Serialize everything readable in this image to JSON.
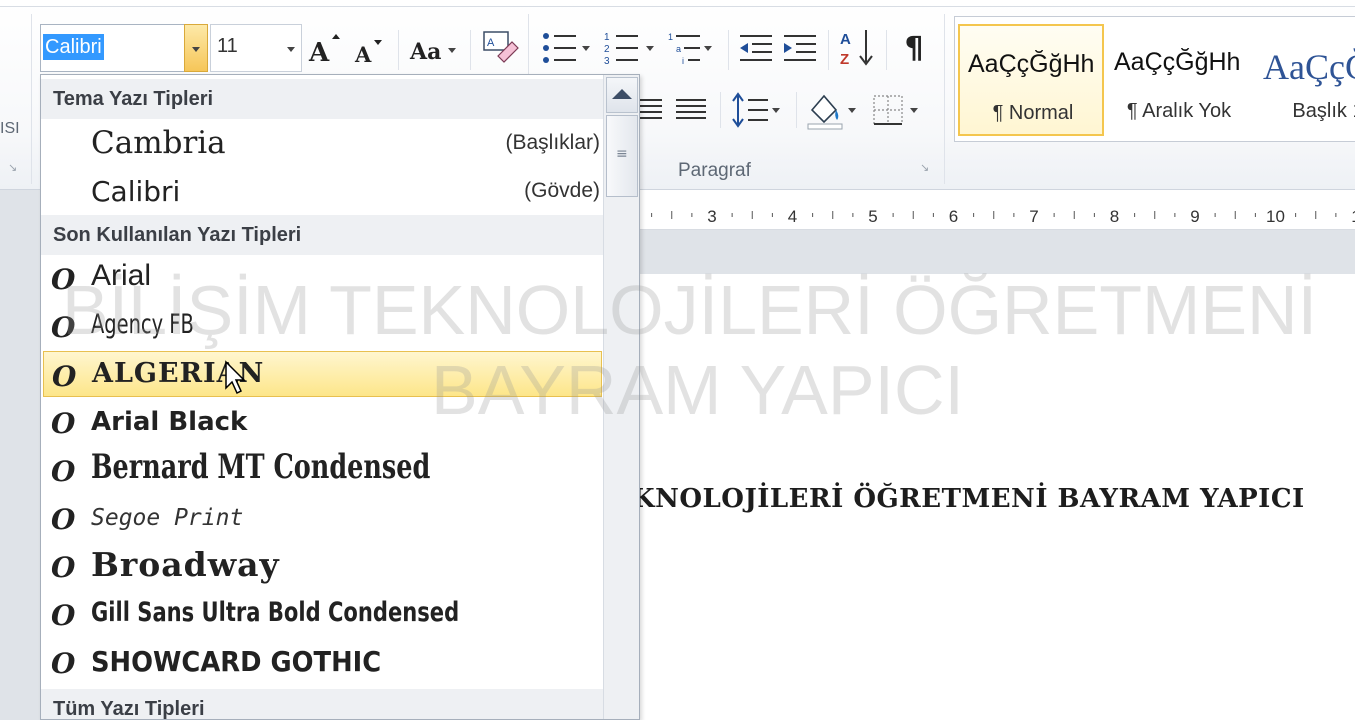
{
  "ribbon": {
    "font_name": "Calibri",
    "font_size": "11",
    "paragraph_label": "Paragraf",
    "left_cut_label": "ISI",
    "pilcrow": "¶",
    "styles": [
      {
        "sample": "AaÇçĞğHh",
        "name": "¶ Normal"
      },
      {
        "sample": "AaÇçĞğHh",
        "name": "¶ Aralık Yok"
      },
      {
        "sample": "AaÇçĞ",
        "name": "Başlık 1"
      }
    ]
  },
  "font_dropdown": {
    "theme_header": "Tema Yazı Tipleri",
    "theme_fonts": [
      {
        "name": "Cambria",
        "role": "(Başlıklar)"
      },
      {
        "name": "Calibri",
        "role": "(Gövde)"
      }
    ],
    "recent_header": "Son Kullanılan Yazı Tipleri",
    "recent_fonts": [
      {
        "name": "Arial"
      },
      {
        "name": "Agency FB"
      },
      {
        "name": "ALGERIAN",
        "highlighted": true
      },
      {
        "name": "Arial Black"
      },
      {
        "name": "Bernard MT Condensed"
      },
      {
        "name": "Segoe Print"
      },
      {
        "name": "Broadway"
      },
      {
        "name": "Gill Sans Ultra Bold Condensed"
      },
      {
        "name": "SHOWCARD GOTHIC"
      }
    ],
    "all_header": "Tüm Yazı Tipleri",
    "font_icon_glyph": "O"
  },
  "ruler": {
    "numbers": [
      "3",
      "4",
      "5",
      "6",
      "7",
      "8",
      "9",
      "10",
      "1"
    ]
  },
  "document": {
    "visible_text": "KNOLOJİLERİ ÖĞRETMENİ BAYRAM YAPICI"
  },
  "watermark": {
    "line1": "BİLİŞİM TEKNOLOJİLERİ ÖĞRETMENİ",
    "line2": "BAYRAM YAPICI"
  }
}
